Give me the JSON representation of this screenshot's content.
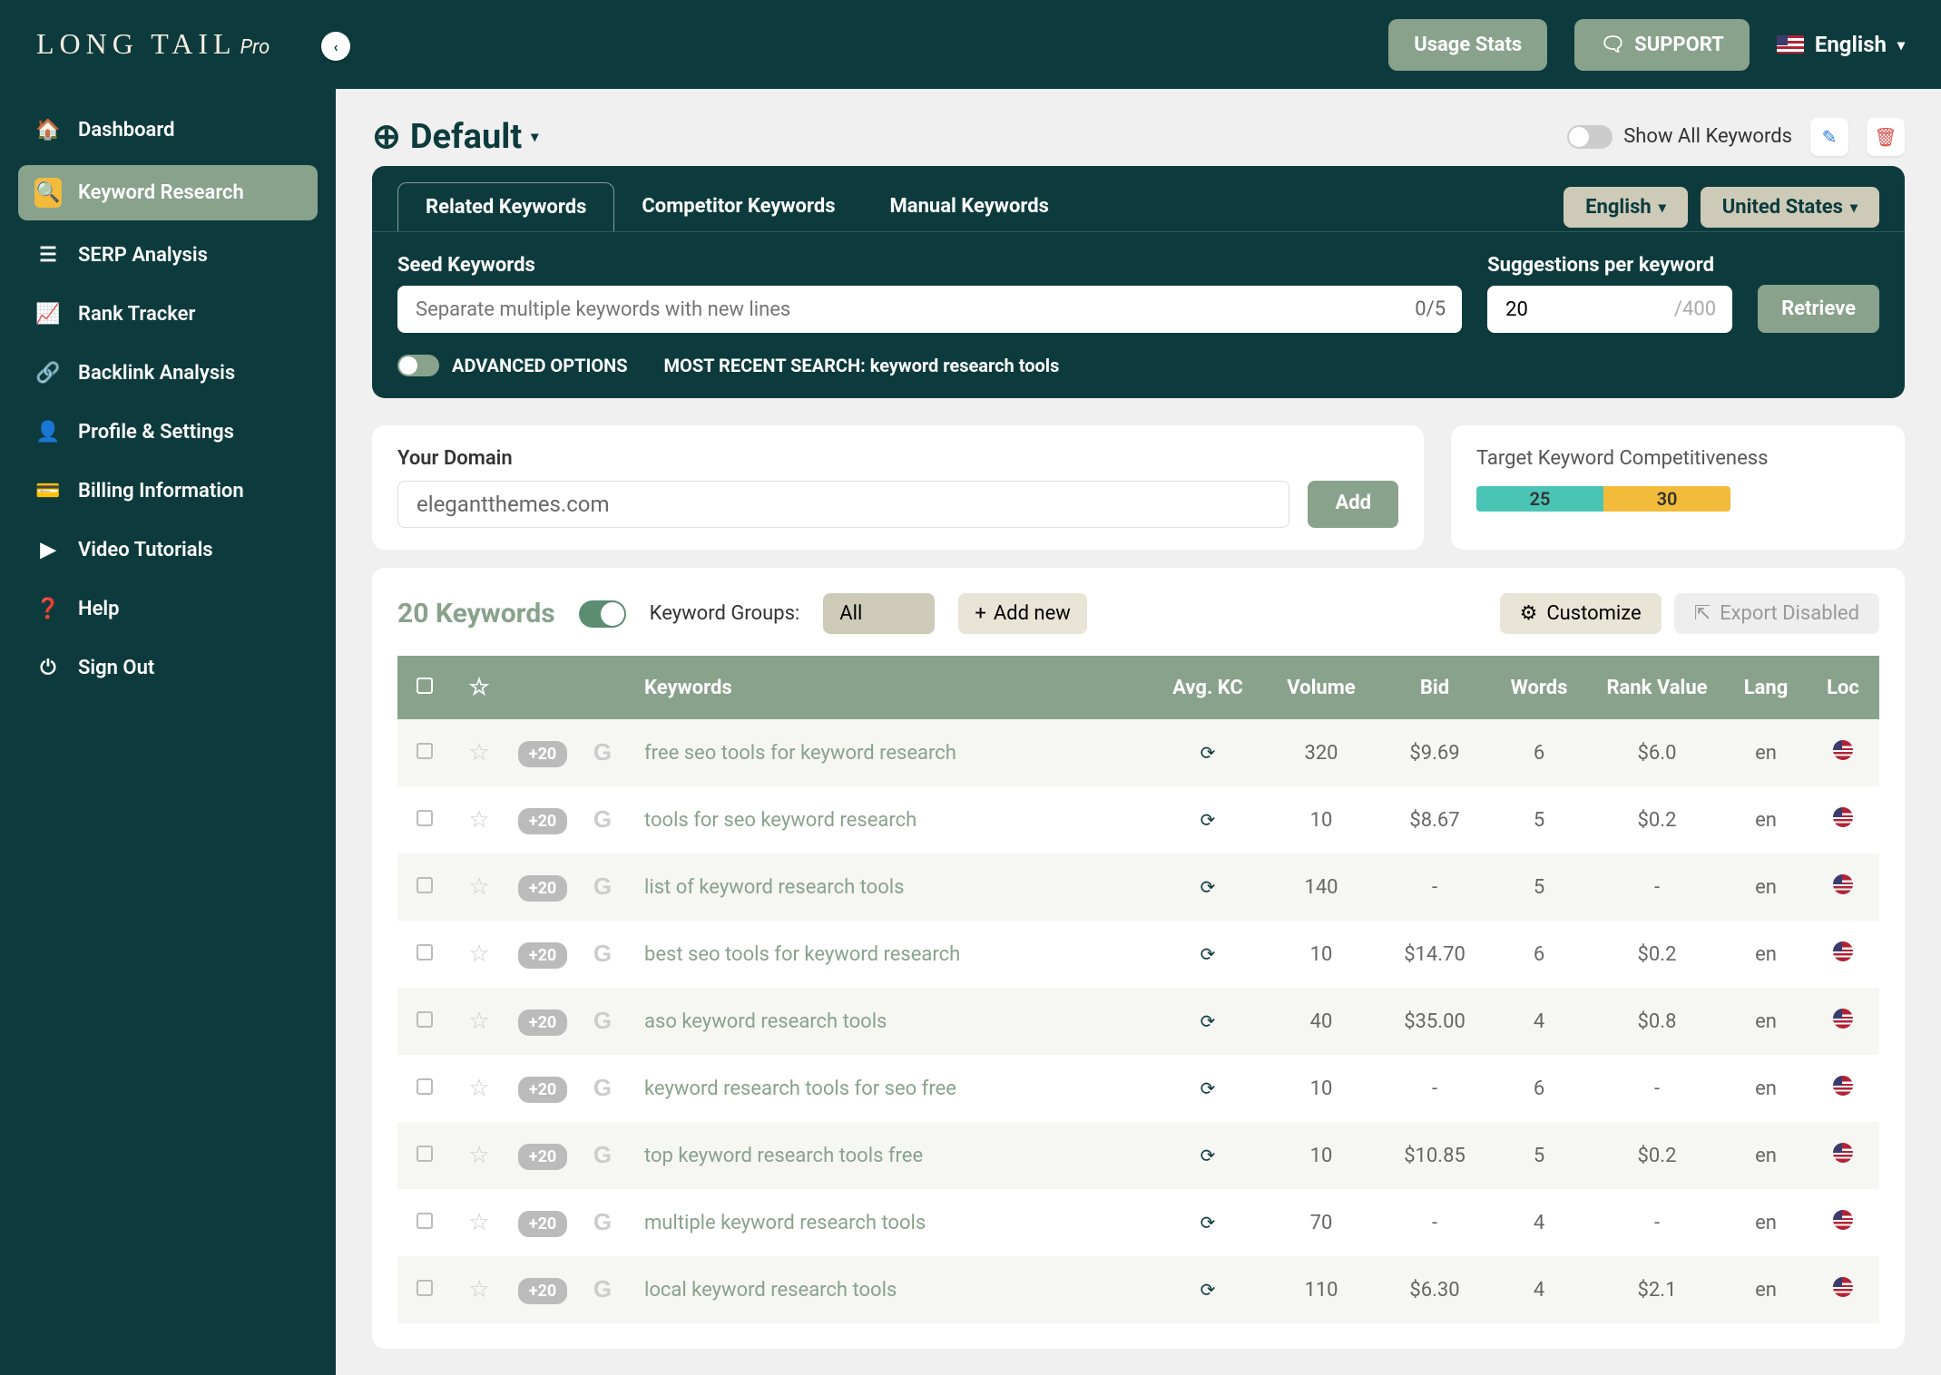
{
  "logo": {
    "main": "LONG TAIL",
    "sub": "Pro"
  },
  "topbar": {
    "usage_stats": "Usage Stats",
    "support": "SUPPORT",
    "language": "English"
  },
  "sidebar": {
    "items": [
      {
        "icon": "home",
        "label": "Dashboard"
      },
      {
        "icon": "search",
        "label": "Keyword Research",
        "active": true
      },
      {
        "icon": "list",
        "label": "SERP Analysis"
      },
      {
        "icon": "chart",
        "label": "Rank Tracker"
      },
      {
        "icon": "link",
        "label": "Backlink Analysis"
      },
      {
        "icon": "user",
        "label": "Profile & Settings"
      },
      {
        "icon": "card",
        "label": "Billing Information"
      },
      {
        "icon": "video",
        "label": "Video Tutorials"
      },
      {
        "icon": "help",
        "label": "Help"
      },
      {
        "icon": "power",
        "label": "Sign Out"
      }
    ]
  },
  "project": {
    "name": "Default",
    "show_all_label": "Show All Keywords"
  },
  "search": {
    "tabs": [
      "Related Keywords",
      "Competitor Keywords",
      "Manual Keywords"
    ],
    "active_tab": 0,
    "lang_btn": "English",
    "country_btn": "United States",
    "seed_label": "Seed Keywords",
    "seed_placeholder": "Separate multiple keywords with new lines",
    "seed_count": "0/5",
    "sugg_label": "Suggestions per keyword",
    "sugg_value": "20",
    "sugg_max": "/400",
    "retrieve": "Retrieve",
    "advanced": "ADVANCED OPTIONS",
    "recent_label": "MOST RECENT SEARCH: ",
    "recent_value": "keyword research tools"
  },
  "domain": {
    "label": "Your Domain",
    "value": "elegantthemes.com",
    "add": "Add"
  },
  "kc": {
    "label": "Target Keyword Competitiveness",
    "low": "25",
    "mid": "30"
  },
  "keywords_header": {
    "count_label": "20 Keywords",
    "groups_label": "Keyword Groups:",
    "group_sel": "All",
    "add_new": "Add new",
    "customize": "Customize",
    "export": "Export Disabled"
  },
  "table": {
    "headers": {
      "kw": "Keywords",
      "kc": "Avg. KC",
      "vol": "Volume",
      "bid": "Bid",
      "words": "Words",
      "rank": "Rank Value",
      "lang": "Lang",
      "loc": "Loc"
    },
    "plus_badge": "+20",
    "rows": [
      {
        "kw": "free seo tools for keyword research",
        "vol": "320",
        "bid": "$9.69",
        "words": "6",
        "rank": "$6.0",
        "lang": "en"
      },
      {
        "kw": "tools for seo keyword research",
        "vol": "10",
        "bid": "$8.67",
        "words": "5",
        "rank": "$0.2",
        "lang": "en"
      },
      {
        "kw": "list of keyword research tools",
        "vol": "140",
        "bid": "-",
        "words": "5",
        "rank": "-",
        "lang": "en"
      },
      {
        "kw": "best seo tools for keyword research",
        "vol": "10",
        "bid": "$14.70",
        "words": "6",
        "rank": "$0.2",
        "lang": "en"
      },
      {
        "kw": "aso keyword research tools",
        "vol": "40",
        "bid": "$35.00",
        "words": "4",
        "rank": "$0.8",
        "lang": "en"
      },
      {
        "kw": "keyword research tools for seo free",
        "vol": "10",
        "bid": "-",
        "words": "6",
        "rank": "-",
        "lang": "en"
      },
      {
        "kw": "top keyword research tools free",
        "vol": "10",
        "bid": "$10.85",
        "words": "5",
        "rank": "$0.2",
        "lang": "en"
      },
      {
        "kw": "multiple keyword research tools",
        "vol": "70",
        "bid": "-",
        "words": "4",
        "rank": "-",
        "lang": "en"
      },
      {
        "kw": "local keyword research tools",
        "vol": "110",
        "bid": "$6.30",
        "words": "4",
        "rank": "$2.1",
        "lang": "en"
      }
    ]
  },
  "nav_icons": {
    "home": "🏠",
    "search": "🔍",
    "list": "☰",
    "chart": "📈",
    "link": "🔗",
    "user": "👤",
    "card": "💳",
    "video": "▶",
    "help": "❓",
    "power": "⏻"
  }
}
